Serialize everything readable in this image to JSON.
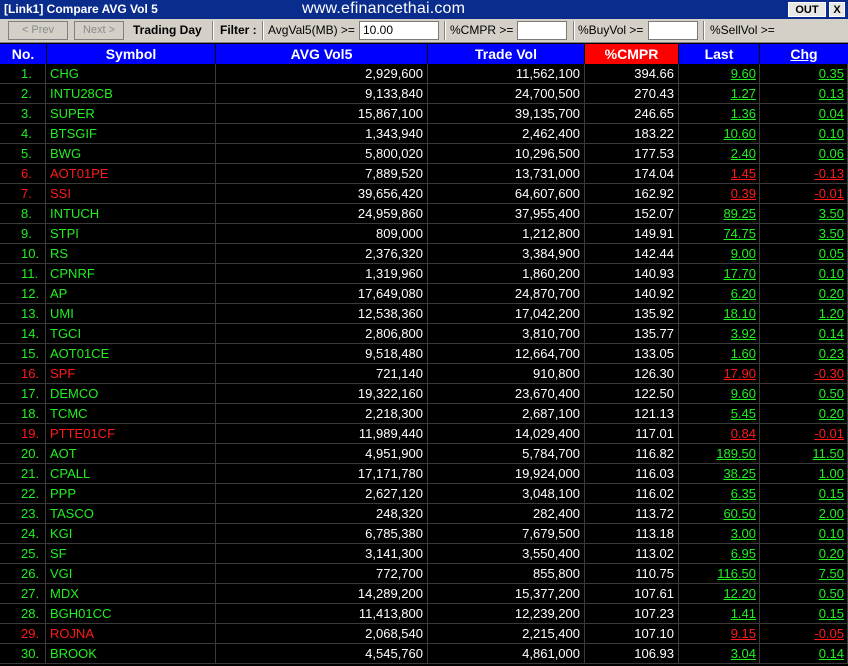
{
  "window": {
    "title": "[Link1] Compare AVG Vol 5",
    "site": "www.efinancethai.com",
    "out_label": "OUT",
    "close_label": "X"
  },
  "toolbar": {
    "prev_label": "< Prev",
    "next_label": "Next >",
    "trading_day_label": "Trading Day",
    "filter_label": "Filter :",
    "avgvol_label": "AvgVal5(MB) >=",
    "avgvol_value": "10.00",
    "cmpr_label": "%CMPR >=",
    "cmpr_value": "",
    "buyvol_label": "%BuyVol >=",
    "buyvol_value": "",
    "sellvol_label": "%SellVol >="
  },
  "table": {
    "headers": {
      "no": "No.",
      "symbol": "Symbol",
      "avg": "AVG Vol5",
      "trade": "Trade Vol",
      "pct": "%CMPR",
      "last": "Last",
      "chg": "Chg"
    },
    "rows": [
      {
        "no": "1.",
        "symbol": "CHG",
        "avg": "2,929,600",
        "trade": "11,562,100",
        "pct": "394.66",
        "last": "9.60",
        "chg": "0.35",
        "dir": "up"
      },
      {
        "no": "2.",
        "symbol": "INTU28CB",
        "avg": "9,133,840",
        "trade": "24,700,500",
        "pct": "270.43",
        "last": "1.27",
        "chg": "0.13",
        "dir": "up"
      },
      {
        "no": "3.",
        "symbol": "SUPER",
        "avg": "15,867,100",
        "trade": "39,135,700",
        "pct": "246.65",
        "last": "1.36",
        "chg": "0.04",
        "dir": "up"
      },
      {
        "no": "4.",
        "symbol": "BTSGIF",
        "avg": "1,343,940",
        "trade": "2,462,400",
        "pct": "183.22",
        "last": "10.60",
        "chg": "0.10",
        "dir": "up"
      },
      {
        "no": "5.",
        "symbol": "BWG",
        "avg": "5,800,020",
        "trade": "10,296,500",
        "pct": "177.53",
        "last": "2.40",
        "chg": "0.06",
        "dir": "up"
      },
      {
        "no": "6.",
        "symbol": "AOT01PE",
        "avg": "7,889,520",
        "trade": "13,731,000",
        "pct": "174.04",
        "last": "1.45",
        "chg": "-0.13",
        "dir": "down"
      },
      {
        "no": "7.",
        "symbol": "SSI",
        "avg": "39,656,420",
        "trade": "64,607,600",
        "pct": "162.92",
        "last": "0.39",
        "chg": "-0.01",
        "dir": "down"
      },
      {
        "no": "8.",
        "symbol": "INTUCH",
        "avg": "24,959,860",
        "trade": "37,955,400",
        "pct": "152.07",
        "last": "89.25",
        "chg": "3.50",
        "dir": "up"
      },
      {
        "no": "9.",
        "symbol": "STPI",
        "avg": "809,000",
        "trade": "1,212,800",
        "pct": "149.91",
        "last": "74.75",
        "chg": "3.50",
        "dir": "up"
      },
      {
        "no": "10.",
        "symbol": "RS",
        "avg": "2,376,320",
        "trade": "3,384,900",
        "pct": "142.44",
        "last": "9.00",
        "chg": "0.05",
        "dir": "up"
      },
      {
        "no": "11.",
        "symbol": "CPNRF",
        "avg": "1,319,960",
        "trade": "1,860,200",
        "pct": "140.93",
        "last": "17.70",
        "chg": "0.10",
        "dir": "up"
      },
      {
        "no": "12.",
        "symbol": "AP",
        "avg": "17,649,080",
        "trade": "24,870,700",
        "pct": "140.92",
        "last": "6.20",
        "chg": "0.20",
        "dir": "up"
      },
      {
        "no": "13.",
        "symbol": "UMI",
        "avg": "12,538,360",
        "trade": "17,042,200",
        "pct": "135.92",
        "last": "18.10",
        "chg": "1.20",
        "dir": "up"
      },
      {
        "no": "14.",
        "symbol": "TGCI",
        "avg": "2,806,800",
        "trade": "3,810,700",
        "pct": "135.77",
        "last": "3.92",
        "chg": "0.14",
        "dir": "up"
      },
      {
        "no": "15.",
        "symbol": "AOT01CE",
        "avg": "9,518,480",
        "trade": "12,664,700",
        "pct": "133.05",
        "last": "1.60",
        "chg": "0.23",
        "dir": "up"
      },
      {
        "no": "16.",
        "symbol": "SPF",
        "avg": "721,140",
        "trade": "910,800",
        "pct": "126.30",
        "last": "17.90",
        "chg": "-0.30",
        "dir": "down"
      },
      {
        "no": "17.",
        "symbol": "DEMCO",
        "avg": "19,322,160",
        "trade": "23,670,400",
        "pct": "122.50",
        "last": "9.60",
        "chg": "0.50",
        "dir": "up"
      },
      {
        "no": "18.",
        "symbol": "TCMC",
        "avg": "2,218,300",
        "trade": "2,687,100",
        "pct": "121.13",
        "last": "5.45",
        "chg": "0.20",
        "dir": "up"
      },
      {
        "no": "19.",
        "symbol": "PTTE01CF",
        "avg": "11,989,440",
        "trade": "14,029,400",
        "pct": "117.01",
        "last": "0.84",
        "chg": "-0.01",
        "dir": "down"
      },
      {
        "no": "20.",
        "symbol": "AOT",
        "avg": "4,951,900",
        "trade": "5,784,700",
        "pct": "116.82",
        "last": "189.50",
        "chg": "11.50",
        "dir": "up"
      },
      {
        "no": "21.",
        "symbol": "CPALL",
        "avg": "17,171,780",
        "trade": "19,924,000",
        "pct": "116.03",
        "last": "38.25",
        "chg": "1.00",
        "dir": "up"
      },
      {
        "no": "22.",
        "symbol": "PPP",
        "avg": "2,627,120",
        "trade": "3,048,100",
        "pct": "116.02",
        "last": "6.35",
        "chg": "0.15",
        "dir": "up"
      },
      {
        "no": "23.",
        "symbol": "TASCO",
        "avg": "248,320",
        "trade": "282,400",
        "pct": "113.72",
        "last": "60.50",
        "chg": "2.00",
        "dir": "up"
      },
      {
        "no": "24.",
        "symbol": "KGI",
        "avg": "6,785,380",
        "trade": "7,679,500",
        "pct": "113.18",
        "last": "3.00",
        "chg": "0.10",
        "dir": "up"
      },
      {
        "no": "25.",
        "symbol": "SF",
        "avg": "3,141,300",
        "trade": "3,550,400",
        "pct": "113.02",
        "last": "6.95",
        "chg": "0.20",
        "dir": "up"
      },
      {
        "no": "26.",
        "symbol": "VGI",
        "avg": "772,700",
        "trade": "855,800",
        "pct": "110.75",
        "last": "116.50",
        "chg": "7.50",
        "dir": "up"
      },
      {
        "no": "27.",
        "symbol": "MDX",
        "avg": "14,289,200",
        "trade": "15,377,200",
        "pct": "107.61",
        "last": "12.20",
        "chg": "0.50",
        "dir": "up"
      },
      {
        "no": "28.",
        "symbol": "BGH01CC",
        "avg": "11,413,800",
        "trade": "12,239,200",
        "pct": "107.23",
        "last": "1.41",
        "chg": "0.15",
        "dir": "up"
      },
      {
        "no": "29.",
        "symbol": "ROJNA",
        "avg": "2,068,540",
        "trade": "2,215,400",
        "pct": "107.10",
        "last": "9.15",
        "chg": "-0.05",
        "dir": "down"
      },
      {
        "no": "30.",
        "symbol": "BROOK",
        "avg": "4,545,760",
        "trade": "4,861,000",
        "pct": "106.93",
        "last": "3.04",
        "chg": "0.14",
        "dir": "up"
      }
    ]
  },
  "colors": {
    "up": "#22ee22",
    "down": "#ff1a1a",
    "header_bg": "#0000ff",
    "sorted_header_bg": "#ff0000",
    "title_bg": "#0a2c8c"
  }
}
